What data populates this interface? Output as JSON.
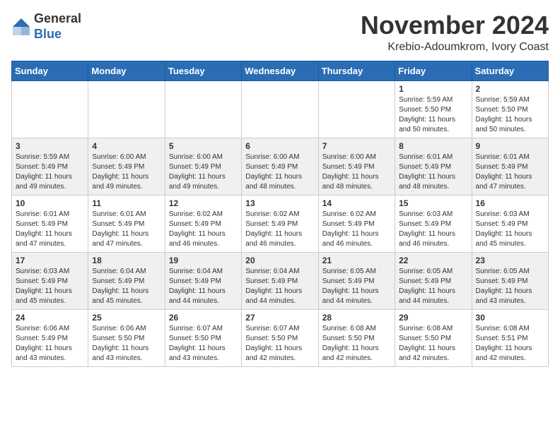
{
  "header": {
    "logo": {
      "line1": "General",
      "line2": "Blue"
    },
    "title": "November 2024",
    "location": "Krebio-Adoumkrom, Ivory Coast"
  },
  "weekdays": [
    "Sunday",
    "Monday",
    "Tuesday",
    "Wednesday",
    "Thursday",
    "Friday",
    "Saturday"
  ],
  "weeks": [
    [
      {
        "day": "",
        "info": ""
      },
      {
        "day": "",
        "info": ""
      },
      {
        "day": "",
        "info": ""
      },
      {
        "day": "",
        "info": ""
      },
      {
        "day": "",
        "info": ""
      },
      {
        "day": "1",
        "info": "Sunrise: 5:59 AM\nSunset: 5:50 PM\nDaylight: 11 hours\nand 50 minutes."
      },
      {
        "day": "2",
        "info": "Sunrise: 5:59 AM\nSunset: 5:50 PM\nDaylight: 11 hours\nand 50 minutes."
      }
    ],
    [
      {
        "day": "3",
        "info": "Sunrise: 5:59 AM\nSunset: 5:49 PM\nDaylight: 11 hours\nand 49 minutes."
      },
      {
        "day": "4",
        "info": "Sunrise: 6:00 AM\nSunset: 5:49 PM\nDaylight: 11 hours\nand 49 minutes."
      },
      {
        "day": "5",
        "info": "Sunrise: 6:00 AM\nSunset: 5:49 PM\nDaylight: 11 hours\nand 49 minutes."
      },
      {
        "day": "6",
        "info": "Sunrise: 6:00 AM\nSunset: 5:49 PM\nDaylight: 11 hours\nand 48 minutes."
      },
      {
        "day": "7",
        "info": "Sunrise: 6:00 AM\nSunset: 5:49 PM\nDaylight: 11 hours\nand 48 minutes."
      },
      {
        "day": "8",
        "info": "Sunrise: 6:01 AM\nSunset: 5:49 PM\nDaylight: 11 hours\nand 48 minutes."
      },
      {
        "day": "9",
        "info": "Sunrise: 6:01 AM\nSunset: 5:49 PM\nDaylight: 11 hours\nand 47 minutes."
      }
    ],
    [
      {
        "day": "10",
        "info": "Sunrise: 6:01 AM\nSunset: 5:49 PM\nDaylight: 11 hours\nand 47 minutes."
      },
      {
        "day": "11",
        "info": "Sunrise: 6:01 AM\nSunset: 5:49 PM\nDaylight: 11 hours\nand 47 minutes."
      },
      {
        "day": "12",
        "info": "Sunrise: 6:02 AM\nSunset: 5:49 PM\nDaylight: 11 hours\nand 46 minutes."
      },
      {
        "day": "13",
        "info": "Sunrise: 6:02 AM\nSunset: 5:49 PM\nDaylight: 11 hours\nand 46 minutes."
      },
      {
        "day": "14",
        "info": "Sunrise: 6:02 AM\nSunset: 5:49 PM\nDaylight: 11 hours\nand 46 minutes."
      },
      {
        "day": "15",
        "info": "Sunrise: 6:03 AM\nSunset: 5:49 PM\nDaylight: 11 hours\nand 46 minutes."
      },
      {
        "day": "16",
        "info": "Sunrise: 6:03 AM\nSunset: 5:49 PM\nDaylight: 11 hours\nand 45 minutes."
      }
    ],
    [
      {
        "day": "17",
        "info": "Sunrise: 6:03 AM\nSunset: 5:49 PM\nDaylight: 11 hours\nand 45 minutes."
      },
      {
        "day": "18",
        "info": "Sunrise: 6:04 AM\nSunset: 5:49 PM\nDaylight: 11 hours\nand 45 minutes."
      },
      {
        "day": "19",
        "info": "Sunrise: 6:04 AM\nSunset: 5:49 PM\nDaylight: 11 hours\nand 44 minutes."
      },
      {
        "day": "20",
        "info": "Sunrise: 6:04 AM\nSunset: 5:49 PM\nDaylight: 11 hours\nand 44 minutes."
      },
      {
        "day": "21",
        "info": "Sunrise: 6:05 AM\nSunset: 5:49 PM\nDaylight: 11 hours\nand 44 minutes."
      },
      {
        "day": "22",
        "info": "Sunrise: 6:05 AM\nSunset: 5:49 PM\nDaylight: 11 hours\nand 44 minutes."
      },
      {
        "day": "23",
        "info": "Sunrise: 6:05 AM\nSunset: 5:49 PM\nDaylight: 11 hours\nand 43 minutes."
      }
    ],
    [
      {
        "day": "24",
        "info": "Sunrise: 6:06 AM\nSunset: 5:49 PM\nDaylight: 11 hours\nand 43 minutes."
      },
      {
        "day": "25",
        "info": "Sunrise: 6:06 AM\nSunset: 5:50 PM\nDaylight: 11 hours\nand 43 minutes."
      },
      {
        "day": "26",
        "info": "Sunrise: 6:07 AM\nSunset: 5:50 PM\nDaylight: 11 hours\nand 43 minutes."
      },
      {
        "day": "27",
        "info": "Sunrise: 6:07 AM\nSunset: 5:50 PM\nDaylight: 11 hours\nand 42 minutes."
      },
      {
        "day": "28",
        "info": "Sunrise: 6:08 AM\nSunset: 5:50 PM\nDaylight: 11 hours\nand 42 minutes."
      },
      {
        "day": "29",
        "info": "Sunrise: 6:08 AM\nSunset: 5:50 PM\nDaylight: 11 hours\nand 42 minutes."
      },
      {
        "day": "30",
        "info": "Sunrise: 6:08 AM\nSunset: 5:51 PM\nDaylight: 11 hours\nand 42 minutes."
      }
    ]
  ]
}
